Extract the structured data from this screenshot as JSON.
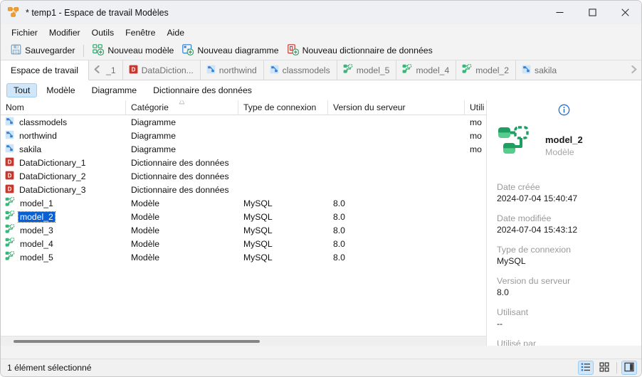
{
  "window": {
    "title": "* temp1 - Espace de travail Modèles",
    "app_icon": "model-nodes-icon",
    "minimize_label": "─",
    "maximize_label": "□",
    "close_label": "✕"
  },
  "menubar": {
    "items": [
      {
        "label": "Fichier"
      },
      {
        "label": "Modifier"
      },
      {
        "label": "Outils"
      },
      {
        "label": "Fenêtre"
      },
      {
        "label": "Aide"
      }
    ]
  },
  "toolbar": {
    "save_label": "Sauvegarder",
    "new_model_label": "Nouveau modèle",
    "new_diagram_label": "Nouveau diagramme",
    "new_dictionary_label": "Nouveau dictionnaire de données"
  },
  "tabstrip": {
    "workspace_tab": "Espace de travail",
    "scroll_left_icon": "chevron-left-icon",
    "scroll_right_icon": "chevron-right-icon",
    "tabs": [
      {
        "label": "_1",
        "icon": "partial-tab",
        "type": "partial"
      },
      {
        "label": "DataDiction...",
        "icon": "dictionary-icon",
        "type": "dictionary"
      },
      {
        "label": "northwind",
        "icon": "diagram-icon",
        "type": "diagram"
      },
      {
        "label": "classmodels",
        "icon": "diagram-icon",
        "type": "diagram"
      },
      {
        "label": "model_5",
        "icon": "model-icon",
        "type": "model"
      },
      {
        "label": "model_4",
        "icon": "model-icon",
        "type": "model"
      },
      {
        "label": "model_2",
        "icon": "model-icon",
        "type": "model"
      },
      {
        "label": "sakila",
        "icon": "diagram-icon",
        "type": "diagram"
      }
    ]
  },
  "filters": {
    "items": [
      {
        "label": "Tout",
        "active": true
      },
      {
        "label": "Modèle",
        "active": false
      },
      {
        "label": "Diagramme",
        "active": false
      },
      {
        "label": "Dictionnaire des données",
        "active": false
      }
    ]
  },
  "table": {
    "columns": [
      {
        "label": "Nom",
        "key": "nom"
      },
      {
        "label": "Catégorie",
        "key": "categorie",
        "sorted": true
      },
      {
        "label": "Type de connexion",
        "key": "type"
      },
      {
        "label": "Version du serveur",
        "key": "version"
      },
      {
        "label": "Utili",
        "key": "utilisant"
      }
    ],
    "rows": [
      {
        "nom": "classmodels",
        "icon": "diagram-icon",
        "categorie": "Diagramme",
        "type": "",
        "version": "",
        "utilisant": "mo",
        "selected": false
      },
      {
        "nom": "northwind",
        "icon": "diagram-icon",
        "categorie": "Diagramme",
        "type": "",
        "version": "",
        "utilisant": "mo",
        "selected": false
      },
      {
        "nom": "sakila",
        "icon": "diagram-icon",
        "categorie": "Diagramme",
        "type": "",
        "version": "",
        "utilisant": "mo",
        "selected": false
      },
      {
        "nom": "DataDictionary_1",
        "icon": "dictionary-icon",
        "categorie": "Dictionnaire des données",
        "type": "",
        "version": "",
        "utilisant": "",
        "selected": false
      },
      {
        "nom": "DataDictionary_2",
        "icon": "dictionary-icon",
        "categorie": "Dictionnaire des données",
        "type": "",
        "version": "",
        "utilisant": "",
        "selected": false
      },
      {
        "nom": "DataDictionary_3",
        "icon": "dictionary-icon",
        "categorie": "Dictionnaire des données",
        "type": "",
        "version": "",
        "utilisant": "",
        "selected": false
      },
      {
        "nom": "model_1",
        "icon": "model-icon",
        "categorie": "Modèle",
        "type": "MySQL",
        "version": "8.0",
        "utilisant": "",
        "selected": false
      },
      {
        "nom": "model_2",
        "icon": "model-icon",
        "categorie": "Modèle",
        "type": "MySQL",
        "version": "8.0",
        "utilisant": "",
        "selected": true
      },
      {
        "nom": "model_3",
        "icon": "model-icon",
        "categorie": "Modèle",
        "type": "MySQL",
        "version": "8.0",
        "utilisant": "",
        "selected": false
      },
      {
        "nom": "model_4",
        "icon": "model-icon",
        "categorie": "Modèle",
        "type": "MySQL",
        "version": "8.0",
        "utilisant": "",
        "selected": false
      },
      {
        "nom": "model_5",
        "icon": "model-icon",
        "categorie": "Modèle",
        "type": "MySQL",
        "version": "8.0",
        "utilisant": "",
        "selected": false
      }
    ]
  },
  "detail": {
    "info_icon": "info-circle-icon",
    "item_icon": "model-icon-large",
    "name": "model_2",
    "type": "Modèle",
    "fields": [
      {
        "label": "Date créée",
        "value": "2024-07-04 15:40:47"
      },
      {
        "label": "Date modifiée",
        "value": "2024-07-04 15:43:12"
      },
      {
        "label": "Type de connexion",
        "value": "MySQL"
      },
      {
        "label": "Version du serveur",
        "value": "8.0"
      },
      {
        "label": "Utilisant",
        "value": "--"
      },
      {
        "label": "Utilisé par",
        "value": ""
      }
    ]
  },
  "statusbar": {
    "text": "1 élément sélectionné",
    "view_list_icon": "list-view-icon",
    "view_grid_icon": "grid-view-icon",
    "detail_panel_icon": "detail-panel-icon"
  },
  "colors": {
    "accent": "#0a5fd4",
    "selection_chip": "#cfe6fb",
    "model_green": "#35b97a",
    "dictionary_red": "#c2392f",
    "diagram_blue": "#2f7fd4",
    "app_orange": "#f0a030"
  }
}
